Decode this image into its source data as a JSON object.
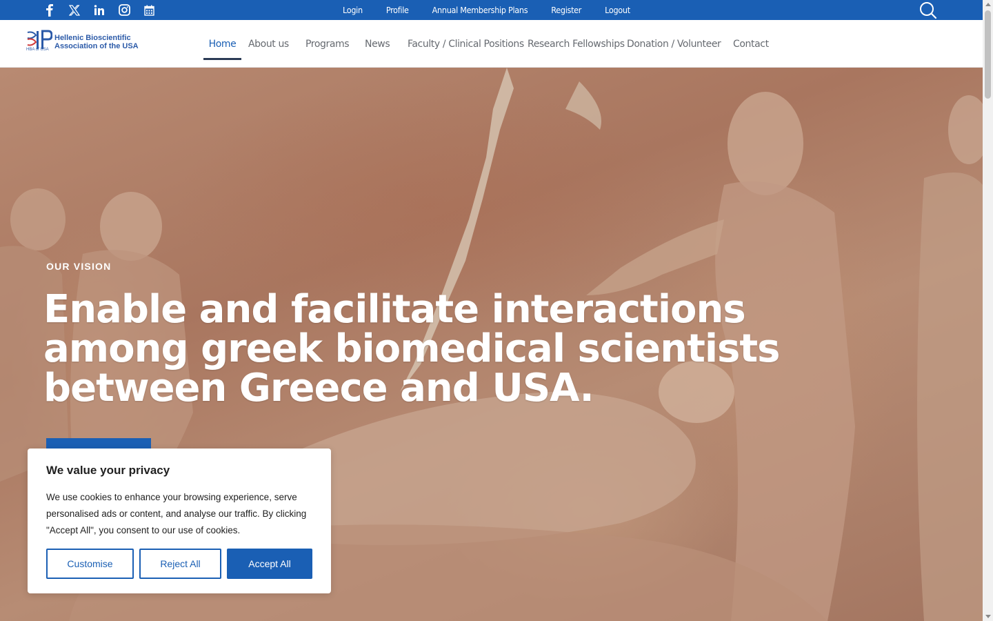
{
  "colors": {
    "brand_blue": "#1a5fb4",
    "nav_text": "#666a70",
    "nav_underline": "#2b3b55",
    "hero_tone": "#b0806a"
  },
  "social": [
    {
      "name": "facebook-icon"
    },
    {
      "name": "x-twitter-icon"
    },
    {
      "name": "linkedin-icon"
    },
    {
      "name": "instagram-icon"
    },
    {
      "name": "calendar-icon"
    }
  ],
  "topbar": {
    "links": [
      "Login",
      "Profile",
      "Annual Membership Plans",
      "Register",
      "Logout"
    ]
  },
  "logo": {
    "line1": "Hellenic Bioscientific",
    "line2": "Association of the USA",
    "sub": "HBA of USA"
  },
  "nav": {
    "items": [
      "Home",
      "About us",
      "Programs",
      "News",
      "Faculty / Clinical Positions",
      "Research Fellowships",
      "Donation / Volunteer",
      "Contact"
    ],
    "active": "Home"
  },
  "hero": {
    "eyebrow": "OUR VISION",
    "headline": "Enable and facilitate interactions among greek biomedical scientists between Greece and USA."
  },
  "cookie": {
    "title": "We value your privacy",
    "text": "We use cookies to enhance your browsing experience, serve personalised ads or content, and analyse our traffic. By clicking \"Accept All\", you consent to our use of cookies.",
    "customise": "Customise",
    "reject": "Reject All",
    "accept": "Accept All"
  }
}
